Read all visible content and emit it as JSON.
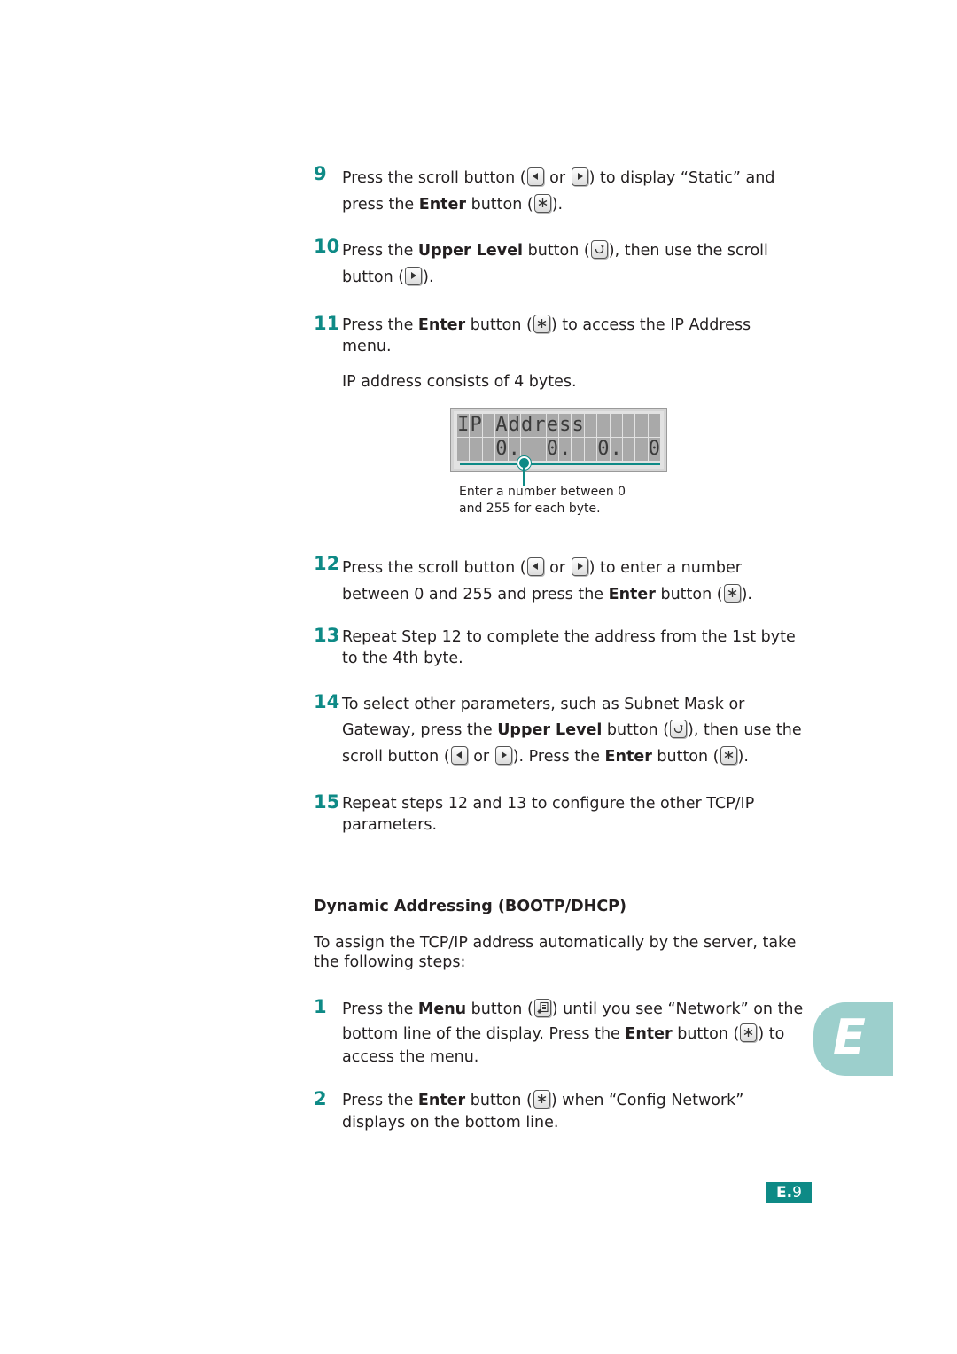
{
  "steps_static": [
    {
      "num": "9",
      "lines": [
        {
          "parts": [
            "Press the scroll button (",
            {
              "key": "left"
            },
            " or ",
            {
              "key": "right"
            },
            ") to display “Static” and"
          ]
        },
        {
          "parts": [
            "press the ",
            {
              "bold": "Enter"
            },
            " button (",
            {
              "key": "enter"
            },
            ")."
          ]
        }
      ]
    },
    {
      "num": "10",
      "lines": [
        {
          "parts": [
            "Press the ",
            {
              "bold": "Upper Level"
            },
            " button (",
            {
              "key": "upper"
            },
            "), then use the scroll"
          ]
        },
        {
          "parts": [
            "button (",
            {
              "key": "right"
            },
            ")."
          ]
        }
      ]
    },
    {
      "num": "11",
      "lines": [
        {
          "parts": [
            "Press the ",
            {
              "bold": "Enter"
            },
            " button (",
            {
              "key": "enter"
            },
            ") to access the IP Address"
          ]
        },
        {
          "parts": [
            "menu."
          ]
        }
      ]
    },
    {
      "num": "12",
      "lines": [
        {
          "parts": [
            "Press the scroll button (",
            {
              "key": "left"
            },
            " or ",
            {
              "key": "right"
            },
            ") to enter a number"
          ]
        },
        {
          "parts": [
            "between 0 and 255 and press the ",
            {
              "bold": "Enter"
            },
            " button (",
            {
              "key": "enter"
            },
            ")."
          ]
        }
      ]
    },
    {
      "num": "13",
      "lines": [
        {
          "parts": [
            "Repeat Step 12 to complete the address from the 1st byte"
          ]
        },
        {
          "parts": [
            "to the 4th byte."
          ]
        }
      ]
    },
    {
      "num": "14",
      "lines": [
        {
          "parts": [
            "To select other parameters, such as Subnet Mask or"
          ]
        },
        {
          "parts": [
            "Gateway, press the ",
            {
              "bold": "Upper Level"
            },
            " button (",
            {
              "key": "upper"
            },
            "), then use the"
          ]
        },
        {
          "parts": [
            "scroll button (",
            {
              "key": "left"
            },
            " or ",
            {
              "key": "right"
            },
            "). Press the ",
            {
              "bold": "Enter"
            },
            " button (",
            {
              "key": "enter"
            },
            ")."
          ]
        }
      ]
    },
    {
      "num": "15",
      "lines": [
        {
          "parts": [
            "Repeat steps  12 and 13 to configure the other TCP/IP"
          ]
        },
        {
          "parts": [
            "parameters."
          ]
        }
      ]
    }
  ],
  "ip_note": "IP address consists of 4 bytes.",
  "lcd": {
    "row1": "IP Address      ",
    "row2": "   0.  0.  0.  0"
  },
  "lcd_caption": [
    "Enter a number between 0",
    "and 255 for each byte."
  ],
  "section_heading": "Dynamic Addressing (BOOTP/DHCP)",
  "intro": "To assign the TCP/IP address automatically by the server, take the following steps:",
  "steps_dynamic": [
    {
      "num": "1",
      "lines": [
        {
          "parts": [
            "Press the ",
            {
              "bold": "Menu"
            },
            " button (",
            {
              "key": "menu"
            },
            ") until you see “Network” on the"
          ]
        },
        {
          "parts": [
            "bottom line of the display. Press the ",
            {
              "bold": "Enter"
            },
            " button (",
            {
              "key": "enter"
            },
            ") to"
          ]
        },
        {
          "parts": [
            "access the menu."
          ]
        }
      ]
    },
    {
      "num": "2",
      "lines": [
        {
          "parts": [
            "Press the ",
            {
              "bold": "Enter"
            },
            " button (",
            {
              "key": "enter"
            },
            ") when “Config Network”"
          ]
        },
        {
          "parts": [
            "displays on the bottom line."
          ]
        }
      ]
    }
  ],
  "chapter_tab": "E",
  "page_number": {
    "prefix": "E.",
    "num": "9"
  },
  "colors": {
    "accent": "#0e8a86",
    "tab": "#9ccfcc"
  }
}
